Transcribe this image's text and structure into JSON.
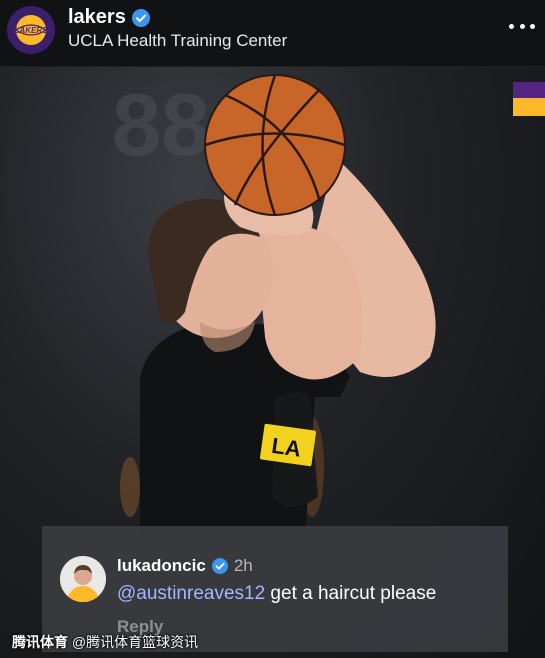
{
  "post": {
    "account_name": "lakers",
    "location": "UCLA Health Training Center",
    "logo_text": "LAKERS"
  },
  "photo": {
    "jersey_text": "LA"
  },
  "comment": {
    "username": "lukadoncic",
    "time": "2h",
    "mention": "@austinreaves12",
    "text": " get a haircut please",
    "reply_label": "Reply"
  },
  "watermark": {
    "brand": "腾讯体育",
    "handle": " @腾讯体育篮球资讯"
  },
  "colors": {
    "verified": "#3897f0",
    "lakers_purple": "#552583",
    "lakers_gold": "#fdb927",
    "mention": "#a3b6ff"
  },
  "icons": [
    "verified-badge-icon",
    "more-options-icon",
    "basketball-icon"
  ]
}
